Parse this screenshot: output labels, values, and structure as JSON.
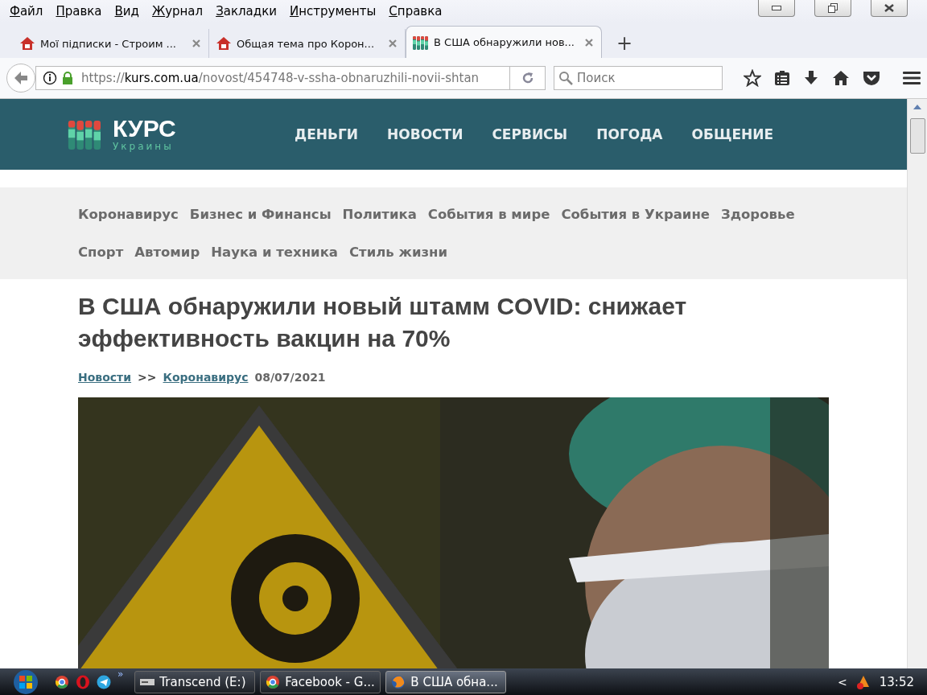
{
  "menu": [
    "Файл",
    "Правка",
    "Вид",
    "Журнал",
    "Закладки",
    "Инструменты",
    "Справка"
  ],
  "tabs": [
    {
      "title": "Мої підписки - Строим ...",
      "selected": false
    },
    {
      "title": "Общая тема про Корон...",
      "selected": false
    },
    {
      "title": "В США обнаружили нов...",
      "selected": true
    }
  ],
  "new_tab": "+",
  "address": {
    "scheme": "https://",
    "host": "kurs.com.ua",
    "path": "/novost/454748-v-ssha-obnaruzhili-novii-shtan"
  },
  "search": {
    "placeholder": "Поиск"
  },
  "site": {
    "logo": {
      "name": "КУРС",
      "tagline": "Украины"
    },
    "nav": [
      "ДЕНЬГИ",
      "НОВОСТИ",
      "СЕРВИСЫ",
      "ПОГОДА",
      "ОБЩЕНИЕ"
    ],
    "categories": [
      [
        "Коронавирус",
        "Бизнес и Финансы",
        "Политика",
        "События в мире",
        "События в Украине",
        "Здоровье"
      ],
      [
        "Спорт",
        "Автомир",
        "Наука и техника",
        "Стиль жизни"
      ]
    ],
    "article": {
      "title": "В США обнаружили новый штамм COVID: снижает эффективность вакцин на 70%",
      "breadcrumb": [
        {
          "kind": "link",
          "text": "Новости"
        },
        {
          "kind": "sep",
          "text": ">>"
        },
        {
          "kind": "link",
          "text": "Коронавирус"
        },
        {
          "kind": "date",
          "text": "08/07/2021"
        }
      ]
    }
  },
  "taskbar": {
    "more": "»",
    "tasks": [
      {
        "label": "Transcend (E:)",
        "selected": false
      },
      {
        "label": "Facebook - G...",
        "selected": false
      },
      {
        "label": "В США обна...",
        "selected": true
      }
    ],
    "tray_arrow": "<",
    "time": "13:52"
  }
}
